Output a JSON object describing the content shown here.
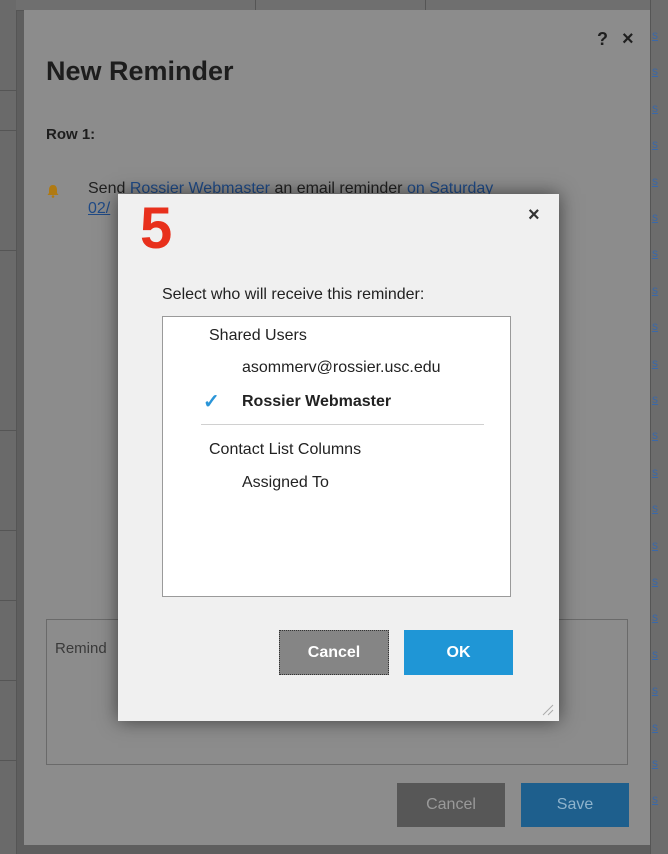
{
  "background": {
    "right_column_cells": [
      "s",
      "s",
      "s",
      "s",
      "s",
      "s",
      "s",
      "s",
      "s",
      "s",
      "s",
      "s",
      "s",
      "s",
      "s",
      "s",
      "s",
      "s",
      "s",
      "s",
      "s",
      "s"
    ]
  },
  "outer_dialog": {
    "help_label": "?",
    "close_label": "×",
    "title": "New Reminder",
    "row_label": "Row 1:",
    "send_text_start": "Send ",
    "send_link_user": "Rossier Webmaster",
    "send_text_mid": " an email reminder ",
    "send_link_date": "on Saturday",
    "send_line2": "02/",
    "reminder_label": "Remind",
    "cancel_label": "Cancel",
    "save_label": "Save"
  },
  "modal": {
    "step_number": "5",
    "close_label": "×",
    "prompt": "Select who will receive this reminder:",
    "shared_users_header": "Shared Users",
    "shared_users": [
      {
        "label": "asommerv@rossier.usc.edu",
        "checked": false
      },
      {
        "label": "Rossier Webmaster",
        "checked": true
      }
    ],
    "contact_columns_header": "Contact List Columns",
    "contact_columns": [
      {
        "label": "Assigned To",
        "checked": false
      }
    ],
    "check_glyph": "✓",
    "cancel_label": "Cancel",
    "ok_label": "OK"
  },
  "colors": {
    "accent_blue": "#1f96d6",
    "step_red": "#e8301c",
    "link_blue": "#1f4a86"
  }
}
